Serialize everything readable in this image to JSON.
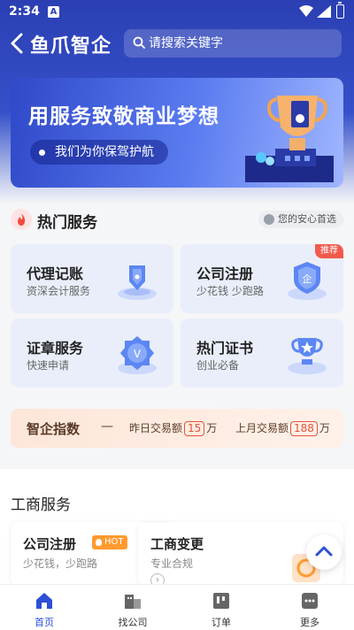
{
  "status_bar": {
    "time": "2:34",
    "notification_badge": "A"
  },
  "header": {
    "app_title": "鱼爪智企",
    "search_placeholder": "请搜索关键字"
  },
  "banner": {
    "title": "用服务致敬商业梦想",
    "subtitle": "我们为你保驾护航"
  },
  "hot_services": {
    "title": "热门服务",
    "badge": "您的安心首选",
    "cards": [
      {
        "title": "代理记账",
        "subtitle": "资深会计服务",
        "icon": "pen-icon"
      },
      {
        "title": "公司注册",
        "subtitle": "少花钱 少跑路",
        "icon": "shield-icon",
        "tag": "推荐",
        "icon_text": "企"
      },
      {
        "title": "证章服务",
        "subtitle": "快速申请",
        "icon": "badge-icon",
        "icon_text": "V"
      },
      {
        "title": "热门证书",
        "subtitle": "创业必备",
        "icon": "trophy-icon"
      }
    ]
  },
  "index_bar": {
    "title": "智企指数",
    "dash": "—",
    "yesterday_label": "昨日交易额",
    "yesterday_value": "15",
    "last_month_label": "上月交易额",
    "last_month_value": "188",
    "unit": "万"
  },
  "business": {
    "title": "工商服务",
    "cards": [
      {
        "title": "公司注册",
        "subtitle": "少花钱，少跑路",
        "hot": "HOT"
      },
      {
        "title": "工商变更",
        "subtitle": "专业合规"
      }
    ]
  },
  "bottom_nav": [
    {
      "label": "首页",
      "active": true
    },
    {
      "label": "找公司"
    },
    {
      "label": "订单"
    },
    {
      "label": "更多"
    }
  ],
  "colors": {
    "primary": "#2d4fd6",
    "accent_red": "#e5533e",
    "hot_orange": "#ff9a2e"
  }
}
